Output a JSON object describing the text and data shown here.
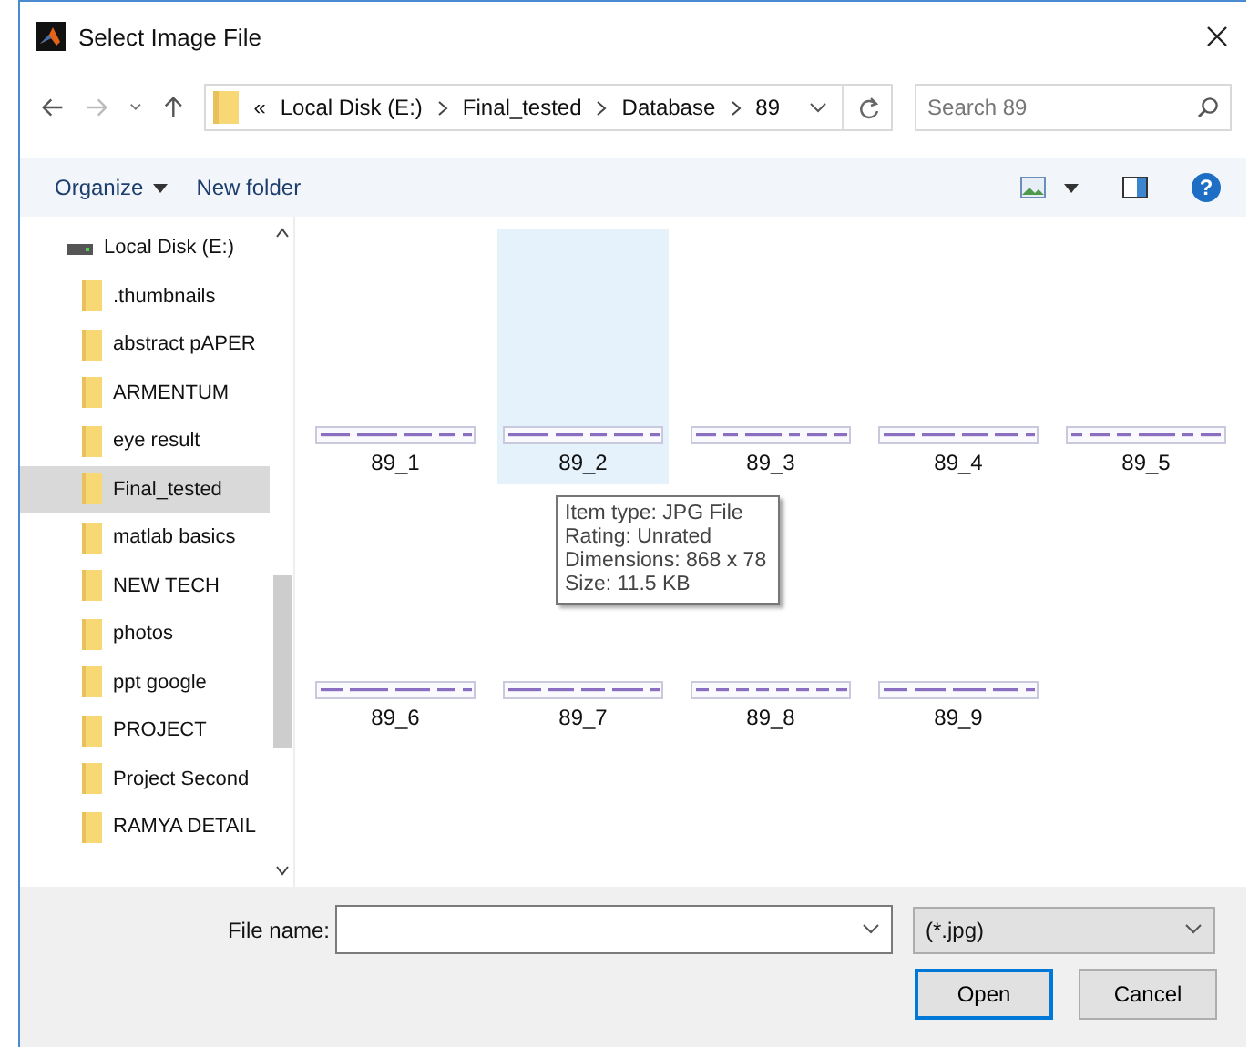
{
  "window": {
    "title": "Select Image File"
  },
  "address": {
    "overflow": "«",
    "path": [
      "Local Disk (E:)",
      "Final_tested",
      "Database",
      "89"
    ]
  },
  "search": {
    "placeholder": "Search 89"
  },
  "toolbar": {
    "organize": "Organize",
    "new_folder": "New folder",
    "help": "?"
  },
  "sidebar": {
    "drive": "Local Disk (E:)",
    "items": [
      {
        "label": ".thumbnails",
        "selected": false
      },
      {
        "label": "abstract pAPER",
        "selected": false
      },
      {
        "label": "ARMENTUM",
        "selected": false
      },
      {
        "label": "eye result",
        "selected": false
      },
      {
        "label": "Final_tested",
        "selected": true
      },
      {
        "label": "matlab basics",
        "selected": false
      },
      {
        "label": "NEW TECH",
        "selected": false
      },
      {
        "label": "photos",
        "selected": false
      },
      {
        "label": "ppt google",
        "selected": false
      },
      {
        "label": "PROJECT",
        "selected": false
      },
      {
        "label": "Project Second",
        "selected": false
      },
      {
        "label": "RAMYA DETAIL",
        "selected": false
      }
    ]
  },
  "files": [
    {
      "name": "89_1",
      "selected": false
    },
    {
      "name": "89_2",
      "selected": true
    },
    {
      "name": "89_3",
      "selected": false
    },
    {
      "name": "89_4",
      "selected": false
    },
    {
      "name": "89_5",
      "selected": false
    },
    {
      "name": "89_6",
      "selected": false
    },
    {
      "name": "89_7",
      "selected": false
    },
    {
      "name": "89_8",
      "selected": false
    },
    {
      "name": "89_9",
      "selected": false
    }
  ],
  "tooltip": {
    "lines": [
      "Item type: JPG File",
      "Rating: Unrated",
      "Dimensions: 868 x 78",
      "Size: 11.5 KB"
    ]
  },
  "bottom": {
    "file_name_label": "File name:",
    "filter": "(*.jpg)",
    "buttons": [
      {
        "label": "Open",
        "default": true
      },
      {
        "label": "Cancel",
        "default": false
      }
    ]
  }
}
